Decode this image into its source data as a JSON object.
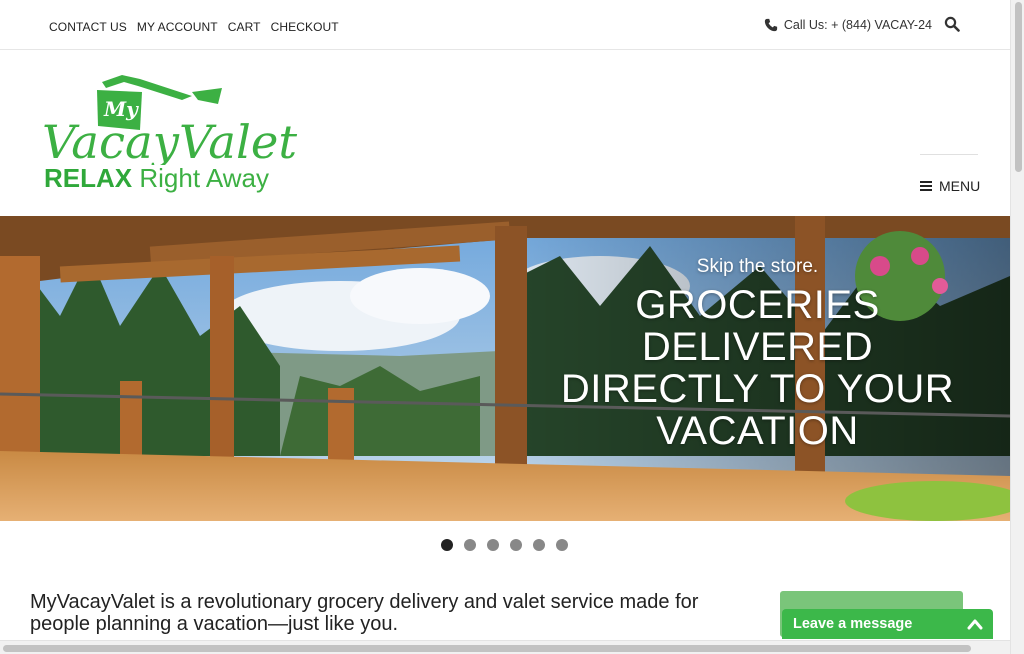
{
  "topnav": {
    "items": [
      "CONTACT US",
      "MY ACCOUNT",
      "CART",
      "CHECKOUT"
    ],
    "call_us": "Call Us: + (844) VACAY-24"
  },
  "logo": {
    "my": "My",
    "name": "VacayValet",
    "tagline_bold": "RELAX",
    "tagline_rest": "Right Away"
  },
  "menu": {
    "label": "MENU"
  },
  "hero": {
    "kicker": "Skip the store.",
    "headline_lines": [
      "GROCERIES",
      "DELIVERED",
      "DIRECTLY TO YOUR",
      "VACATION"
    ],
    "slide_count": 6,
    "active_slide": 1
  },
  "intro": {
    "text": "MyVacayValet is a revolutionary grocery delivery and valet service made for people planning a vacation—just like you."
  },
  "chat": {
    "label": "Leave a message"
  },
  "colors": {
    "brand_green": "#3cb043",
    "chat_green": "#3cb84a",
    "cta_green": "#7ac57a"
  },
  "icons": {
    "phone": "phone-icon",
    "search": "search-icon",
    "menu": "hamburger-icon",
    "chat_toggle": "chevron-up-icon"
  }
}
